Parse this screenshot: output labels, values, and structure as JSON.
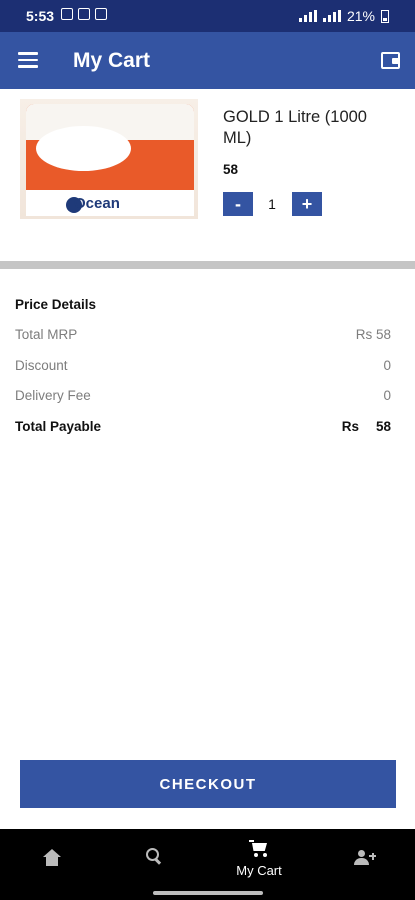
{
  "status_bar": {
    "time": "5:53",
    "battery": "21%"
  },
  "app_bar": {
    "title": "My Cart"
  },
  "cart_item": {
    "name": "GOLD 1 Litre (1000 ML)",
    "price": "58",
    "quantity": "1",
    "minus_label": "-",
    "plus_label": "+",
    "image_brand_text": "Ocean"
  },
  "price_details": {
    "heading": "Price Details",
    "total_mrp_label": "Total MRP",
    "total_mrp_value": "Rs 58",
    "discount_label": "Discount",
    "discount_value": "0",
    "delivery_label": "Delivery Fee",
    "delivery_value": "0",
    "total_payable_label": "Total Payable",
    "total_payable_currency": "Rs",
    "total_payable_value": "58"
  },
  "checkout_label": "CHECKOUT",
  "bottom_nav": {
    "items": [
      {
        "icon": "home-icon",
        "label": ""
      },
      {
        "icon": "search-icon",
        "label": ""
      },
      {
        "icon": "cart-icon",
        "label": "My Cart"
      },
      {
        "icon": "people-icon",
        "label": ""
      }
    ]
  },
  "colors": {
    "status_bar": "#1c2f73",
    "primary": "#3454a2",
    "nav_bg": "#000000"
  }
}
